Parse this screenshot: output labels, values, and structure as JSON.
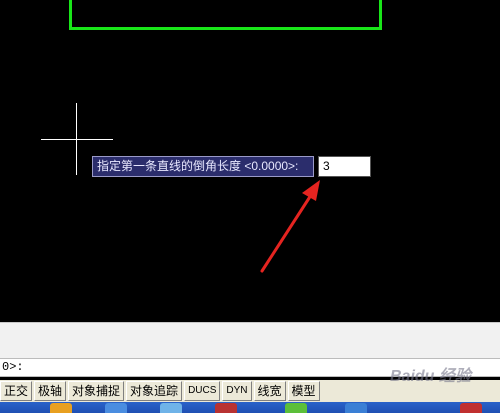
{
  "dynamic_input": {
    "prompt_label": "指定第一条直线的倒角长度 <0.0000>:",
    "value": "3"
  },
  "command_line": {
    "text": "0>:"
  },
  "status_bar": {
    "buttons": [
      "正交",
      "极轴",
      "对象捕捉",
      "对象追踪",
      "DUCS",
      "DYN",
      "线宽",
      "模型"
    ]
  },
  "colors": {
    "canvas": "#000000",
    "geometry": "#19e619",
    "prompt_bg": "#2b2d6c",
    "arrow": "#e52420"
  },
  "watermark": "Baidu 经验"
}
